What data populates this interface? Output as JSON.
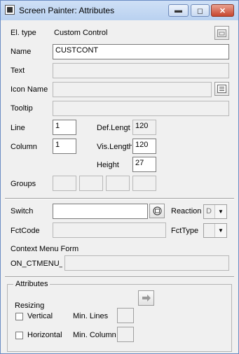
{
  "window": {
    "title": "Screen Painter: Attributes",
    "minimize_glyph": "▬",
    "restore_glyph": "◻",
    "close_glyph": "✕"
  },
  "fields": {
    "el_type_label": "El. type",
    "el_type_value": "Custom Control",
    "name_label": "Name",
    "name_value": "CUSTCONT",
    "text_label": "Text",
    "text_value": "",
    "icon_name_label": "Icon Name",
    "icon_name_value": "",
    "tooltip_label": "Tooltip",
    "tooltip_value": "",
    "line_label": "Line",
    "line_value": "1",
    "column_label": "Column",
    "column_value": "1",
    "def_length_label": "Def.Lengt",
    "def_length_value": "120",
    "vis_length_label": "Vis.Length",
    "vis_length_value": "120",
    "height_label": "Height",
    "height_value": "27",
    "groups_label": "Groups",
    "groups_values": [
      "",
      "",
      "",
      ""
    ]
  },
  "lower": {
    "switch_label": "Switch",
    "switch_value": "",
    "reaction_label": "Reaction",
    "reaction_value": "D",
    "fctcode_label": "FctCode",
    "fctcode_value": "",
    "fcttype_label": "FctType",
    "fcttype_value": "",
    "context_menu_label": "Context Menu Form",
    "context_menu_prefix": "ON_CTMENU_",
    "context_menu_value": ""
  },
  "attributes": {
    "group_title": "Attributes",
    "resizing_label": "Resizing",
    "vertical_label": "Vertical",
    "horizontal_label": "Horizontal",
    "min_lines_label": "Min. Lines",
    "min_columns_label": "Min. Columns",
    "min_lines_value": "",
    "min_columns_value": "",
    "vertical_checked": false,
    "horizontal_checked": false
  },
  "icons": {
    "window_icon": "app-icon",
    "el_type_icon": "element-type-icon",
    "icon_picker": "list-icon",
    "switch_picker": "select-icon",
    "forward": "right-arrow-icon"
  }
}
